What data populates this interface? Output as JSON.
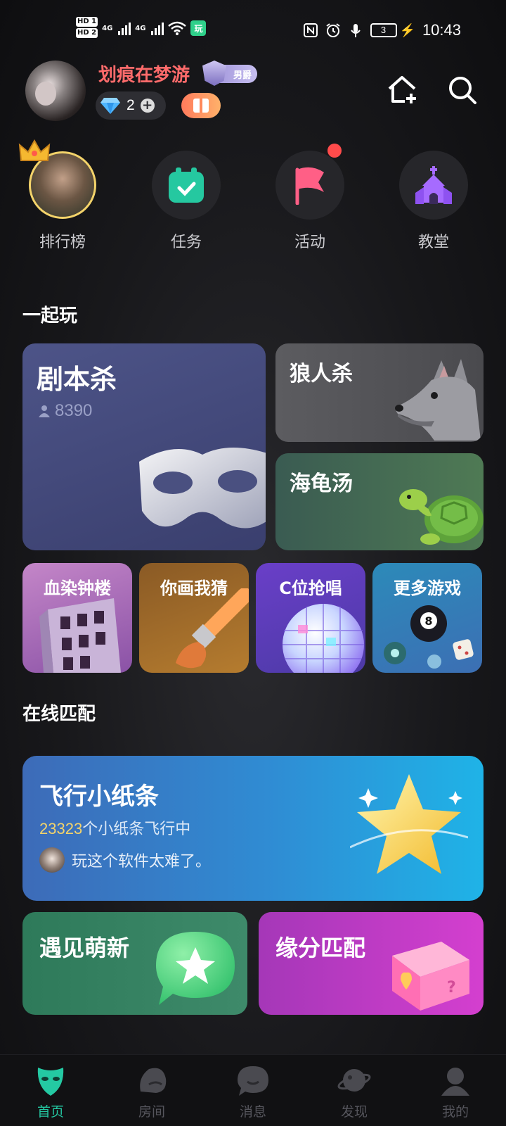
{
  "status_bar": {
    "sim1": "HD 1",
    "sim2": "HD 2",
    "net1": "4G",
    "net2": "4G",
    "app_badge": "玩",
    "battery": "3",
    "time": "10:43"
  },
  "profile": {
    "username": "划痕在梦游",
    "vip_label": "男爵",
    "diamonds": "2"
  },
  "quick_entries": [
    {
      "label": "排行榜"
    },
    {
      "label": "任务"
    },
    {
      "label": "活动"
    },
    {
      "label": "教堂"
    }
  ],
  "play_together": {
    "title": "一起玩",
    "featured": {
      "title": "剧本杀",
      "online": "8390"
    },
    "werewolf": {
      "title": "狼人杀"
    },
    "turtle_soup": {
      "title": "海龟汤"
    },
    "small_games": [
      {
        "title": "血染钟楼"
      },
      {
        "title": "你画我猜"
      },
      {
        "title": "C位抢唱"
      },
      {
        "title": "更多游戏"
      }
    ]
  },
  "online_match": {
    "title": "在线匹配",
    "note": {
      "title": "飞行小纸条",
      "count": "23323",
      "count_suffix": "个小纸条飞行中",
      "message": "玩这个软件太难了。"
    },
    "meet_new": {
      "title": "遇见萌新"
    },
    "fate_match": {
      "title": "缘分匹配"
    }
  },
  "bottom_nav": [
    {
      "label": "首页",
      "icon": "mask-icon",
      "active": true
    },
    {
      "label": "房间",
      "icon": "room-icon"
    },
    {
      "label": "消息",
      "icon": "message-icon"
    },
    {
      "label": "发现",
      "icon": "planet-icon"
    },
    {
      "label": "我的",
      "icon": "profile-icon"
    }
  ],
  "colors": {
    "accent": "#24c9a3",
    "username": "#ff6b6b",
    "highlight": "#f3d36a"
  }
}
